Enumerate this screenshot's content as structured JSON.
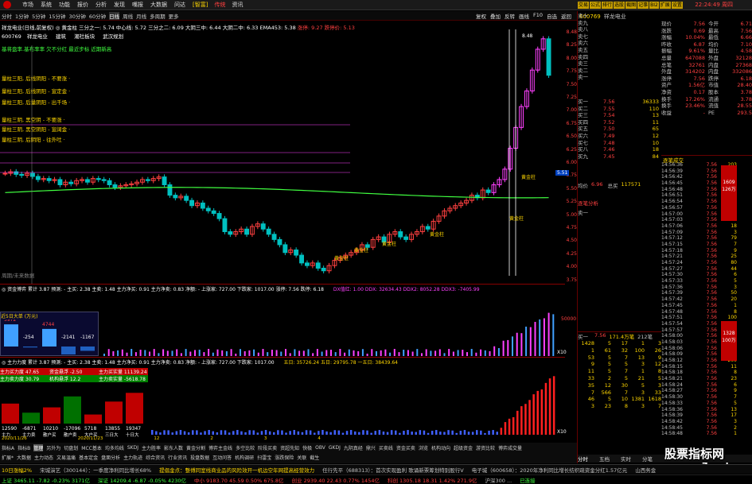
{
  "titlebar": {
    "menu": [
      "市场",
      "系统",
      "功能",
      "报价",
      "分析",
      "发现",
      "嘴报",
      "大数据",
      "问达"
    ],
    "tags": [
      "[智富]",
      "传统",
      "资讯"
    ],
    "time": "22:24:49 周四"
  },
  "toolbar": {
    "periods": [
      "分时",
      "1分钟",
      "5分钟",
      "15分钟",
      "30分钟",
      "60分钟",
      "日线",
      "周线",
      "月线",
      "多周期",
      "更多"
    ],
    "selected": "日线",
    "right": [
      "复权",
      "叠加",
      "反转",
      "画线",
      "F10",
      "自选",
      "返回"
    ]
  },
  "rightbtns": [
    "交易",
    "公式",
    "排行",
    "选股",
    "截图",
    "记事",
    "BI2",
    "扩展",
    "设置"
  ],
  "main": {
    "code_row": "祥龙电业(日线,前复权) ◎ 黄金柱 三分之一: 5.74 中心线: 5.72 三分之二: 6.09 大阴三中: 6.44 大阴二中: 6.33 EMA453: 5.38",
    "code_row2": "涨停: 9.27 跌停价: 5.13",
    "info": [
      "600769",
      "祥龙电业",
      "建筑",
      "潮社板块",
      "武汉规划"
    ],
    "note": "基将盘率.基布率率 欠不分红 最近步标 近期新高",
    "labels": [
      "量柱三阳, 后线阴阳 - 不要涨 ·",
      "量柱三阳, 后线阴阳 - 宣定金 ·",
      "量柱三阳, 后量阴阳 - 出千场 ·",
      "量柱三阴, 黑空阴 - 不要涨 ·",
      "量柱三阴, 黑空阴阳 - 宣阔金 ·",
      "量柱三阴, 后阴阳 - 往外吐 ·"
    ],
    "yaxis": [
      "8.48",
      "8.25",
      "8.00",
      "7.75",
      "7.50",
      "7.25",
      "7.00",
      "6.75",
      "6.50",
      "6.25",
      "6.00",
      "5.75",
      "5.50",
      "5.25",
      "5.00",
      "4.75",
      "4.50",
      "4.25",
      "4.00",
      "3.75"
    ],
    "price_box": "5.51",
    "gold": [
      "黄金柱",
      "黄金柱",
      "黄金柱",
      "黄金柱",
      "黄金柱",
      "黄金柱"
    ],
    "foot": "周期/未来数据",
    "top_label": "8.48"
  },
  "pane1": {
    "hdr": "◎ 资金博弈 累计 3.87 预测: - 主买: 2.38 主卖: 1.48 主力净买: 0.91 主力净卖: 0.83 净额: - 上涨家: 727.00 下跌家: 1017.00 涨停: 7.56 跌停: 6.18",
    "hdr2": "DX值红: 1.00 DDX: 32634.43 DDX2: 8052.28 DDX3: -7405.99",
    "box_title": "近5日大单 (万元)",
    "box_vals": [
      "5972",
      "-254",
      "4744",
      "-2141",
      "-1167"
    ],
    "yl": "50000",
    "x10": "X10"
  },
  "pane2": {
    "hdr": "◎ 主力力度 累计 3.87 预测: - 主买: 2.38 主卖: 1.48 主力净买: 0.91 主力净卖: 0.83 净额: - 上涨家: 727.00 下跌家: 1017.00",
    "hdr2": "五日: 35726.24 五日: 29795.78 一五日: 38439.64",
    "labels": [
      "主力买力度 47.65",
      "主力卖力度 30.79",
      "资金悬浮 -2.50",
      "机构悬浮 12.2",
      "主力买实量 11139.24",
      "主力卖实量 -5618.78"
    ],
    "bars": [
      "12590",
      "-6871",
      "10210",
      "-17096",
      "5718",
      "13855",
      "19347"
    ],
    "barlbl": [
      "主力",
      "主力卖",
      "散户买",
      "散户卖",
      "大户买",
      "三日大",
      "十日大"
    ]
  },
  "xaxis": [
    "2020/11/26",
    "2020/11/23",
    "12",
    "2",
    "3",
    "4"
  ],
  "tabs": {
    "r1": [
      "指标A",
      "指标B",
      "管理",
      "另外为",
      "切盘划",
      "MCC基本",
      "均多均线",
      "SKDJ",
      "主力胜率",
      "影东人数",
      "黄金分割",
      "博弈主金线",
      "多空比较",
      "阶段买卖",
      "资超先知",
      "快极",
      "OBV",
      "GKDJ",
      "九阴真经",
      "鼎兴",
      "买卖线",
      "资金买卖",
      "浏览 ",
      "机构动向",
      "超级资金",
      "游资比较",
      "博弈成交量"
    ],
    "r2": [
      "扩展*",
      "大数据 ",
      "主力动态",
      "文易温痛",
      "基本定金",
      "盘面分析",
      "主力轨迹",
      "综合资讯",
      "行业资讯",
      "投盘数据",
      "互动问答",
      "机构调研",
      "扫雷宝",
      "涨跌保险",
      "关联",
      "截生"
    ],
    "sel": "管理"
  },
  "rp": {
    "code": "600769",
    "name": "祥龙电业",
    "sell": [
      [
        "卖十",
        "",
        ""
      ],
      [
        "卖九",
        "",
        ""
      ],
      [
        "卖八",
        "",
        ""
      ],
      [
        "卖七",
        "",
        ""
      ],
      [
        "卖六",
        "",
        ""
      ],
      [
        "卖五",
        "",
        ""
      ],
      [
        "卖四",
        "",
        ""
      ],
      [
        "卖三",
        "",
        ""
      ],
      [
        "卖二",
        "",
        ""
      ],
      [
        "卖一",
        "",
        ""
      ]
    ],
    "buy": [
      [
        "买一",
        "7.56",
        "36333"
      ],
      [
        "买二",
        "7.55",
        "110"
      ],
      [
        "买三",
        "7.54",
        "13"
      ],
      [
        "买四",
        "7.52",
        "11"
      ],
      [
        "买五",
        "7.50",
        "65"
      ],
      [
        "买六",
        "7.49",
        "12"
      ],
      [
        "买七",
        "7.48",
        "10"
      ],
      [
        "买八",
        "7.46",
        "18"
      ],
      [
        "买九",
        "7.45",
        "84"
      ]
    ],
    "jun": [
      "均价",
      "6.96",
      "总卖",
      "",
      "总买",
      "117571"
    ],
    "quote": [
      [
        "现价",
        "7.56",
        "今开",
        "6.71"
      ],
      [
        "涨跌",
        "0.69",
        "最高",
        "7.56"
      ],
      [
        "涨幅",
        "10.04%",
        "最低",
        "6.66"
      ],
      [
        "昨收",
        "6.87",
        "均价",
        "7.10"
      ],
      [
        "振幅",
        "9.61%",
        "量比",
        "4.58"
      ],
      [
        "总量",
        "647088",
        "外盘",
        "32128"
      ],
      [
        "总笔",
        "32761",
        "内盘",
        "27368"
      ],
      [
        "外盘",
        "314202",
        "内盘",
        "332086"
      ],
      [
        "涨停",
        "7.56",
        "跌停",
        "6.18"
      ],
      [
        "资产",
        "1.56亿",
        "市值",
        "28.40"
      ],
      [
        "净资",
        "0.17",
        "股本",
        "3.78"
      ],
      [
        "换手",
        "17.26%",
        "流通",
        "3.78"
      ],
      [
        "换手",
        "23.46%",
        "流值",
        "28.55"
      ],
      [
        "收益",
        "-",
        "PE",
        "293.5"
      ]
    ],
    "ticks": [
      [
        "14:56:36",
        "7.56",
        "203"
      ],
      [
        "14:56:39",
        "7.56",
        "8"
      ],
      [
        "14:56:42",
        "7.56",
        "8"
      ],
      [
        "14:56:45",
        "7.56",
        "190"
      ],
      [
        "14:56:48",
        "7.56",
        "2000"
      ],
      [
        "14:56:51",
        "7.56",
        "2"
      ],
      [
        "14:56:54",
        "7.56",
        "13"
      ],
      [
        "14:56:57",
        "7.56",
        "1"
      ],
      [
        "14:57:00",
        "7.56",
        "2"
      ],
      [
        "14:57:03",
        "7.56",
        "80"
      ],
      [
        "14:57:06",
        "7.56",
        "18"
      ],
      [
        "14:57:09",
        "7.56",
        "3"
      ],
      [
        "14:57:12",
        "7.56",
        "79"
      ],
      [
        "14:57:15",
        "7.56",
        "7"
      ],
      [
        "14:57:18",
        "7.56",
        "9"
      ],
      [
        "14:57:21",
        "7.56",
        "25"
      ],
      [
        "14:57:24",
        "7.56",
        "80"
      ],
      [
        "14:57:27",
        "7.56",
        "44"
      ],
      [
        "14:57:30",
        "7.56",
        "6"
      ],
      [
        "14:57:33",
        "7.56",
        "5"
      ],
      [
        "14:57:36",
        "7.56",
        "3"
      ],
      [
        "14:57:39",
        "7.56",
        "50"
      ],
      [
        "14:57:42",
        "7.56",
        "20"
      ],
      [
        "14:57:45",
        "7.56",
        "1"
      ],
      [
        "14:57:48",
        "7.56",
        "8"
      ],
      [
        "14:57:51",
        "7.56",
        "100"
      ],
      [
        "14:57:54",
        "7.56",
        "2"
      ],
      [
        "14:57:57",
        "7.56",
        "6"
      ],
      [
        "14:58:00",
        "7.56",
        "10"
      ],
      [
        "14:58:03",
        "7.56",
        "15"
      ],
      [
        "14:58:06",
        "7.56",
        "4"
      ],
      [
        "14:58:09",
        "7.56",
        "3"
      ],
      [
        "14:58:12",
        "7.56",
        "200"
      ],
      [
        "14:58:15",
        "7.56",
        "11"
      ],
      [
        "14:58:18",
        "7.56",
        "8"
      ],
      [
        "14:58:21",
        "7.56",
        "23"
      ],
      [
        "14:58:24",
        "7.56",
        "6"
      ],
      [
        "14:58:27",
        "7.56",
        "9"
      ],
      [
        "14:58:30",
        "7.56",
        "7"
      ],
      [
        "14:58:33",
        "7.56",
        "5"
      ],
      [
        "14:58:36",
        "7.56",
        "13"
      ],
      [
        "14:58:39",
        "7.56",
        "17"
      ],
      [
        "14:58:42",
        "7.56",
        "3"
      ],
      [
        "14:58:45",
        "7.56",
        "2"
      ],
      [
        "14:58:48",
        "7.56",
        "1"
      ]
    ],
    "section": "逐笔成交",
    "reds": [
      "1609",
      "126万",
      "1328",
      "100万"
    ],
    "analysis": "逐笔分析",
    "sell1": "卖一",
    "buy1b": "买一",
    "b1p": "7.56",
    "b1v": "171.4万笔",
    "b1r": "212笔",
    "grid": [
      [
        "1428",
        "5",
        "17",
        "1",
        "3"
      ],
      [
        "1",
        "61",
        "32",
        "100",
        "26"
      ],
      [
        "53",
        "5",
        "7",
        "13",
        "9"
      ],
      [
        "9",
        "5",
        "5",
        "3",
        "12"
      ],
      [
        "11",
        "5",
        "7",
        "1",
        "8"
      ],
      [
        "33",
        "2",
        "5",
        "21",
        "5"
      ],
      [
        "35",
        "12",
        "30",
        "5",
        "3"
      ],
      [
        "7",
        "566",
        "7",
        "3",
        "33"
      ],
      [
        "46",
        "5",
        "10",
        "1381",
        "1618"
      ],
      [
        "3",
        "23",
        "8",
        "3",
        "7"
      ]
    ],
    "tabs2": [
      "分时",
      "五档",
      "实时",
      "分笔"
    ]
  },
  "status": {
    "items": [
      "10日涨幅2%",
      "宋城演艺（300144）：一季度净利同比增长68%",
      "提倡金点：整傅同室线商业品的风险效开一机边空年网提高经营效力",
      "任行先平（688313）：首次实现盈利 歌诵新票筹划特别股行V",
      "电子城（600658）：2020年净利同比增长纺织疏资金分红1.57亿元",
      "山西务金"
    ]
  },
  "status2": {
    "items": [
      "上证 3465.11 -7.82 -0.23% 3171亿",
      "深证 14209.4 -6.87 -0.05% 4230亿",
      "中小 9183.70 45.59 0.50% 675.8亿",
      "创业 2939.40 22.43 0.77% 1454亿",
      "科创 1305.18 18.31 1.42% 271.9亿",
      "沪深300 ...",
      "已连接"
    ]
  },
  "watermark": "股票指标网",
  "watermark2": "www.7gpzb.com"
}
